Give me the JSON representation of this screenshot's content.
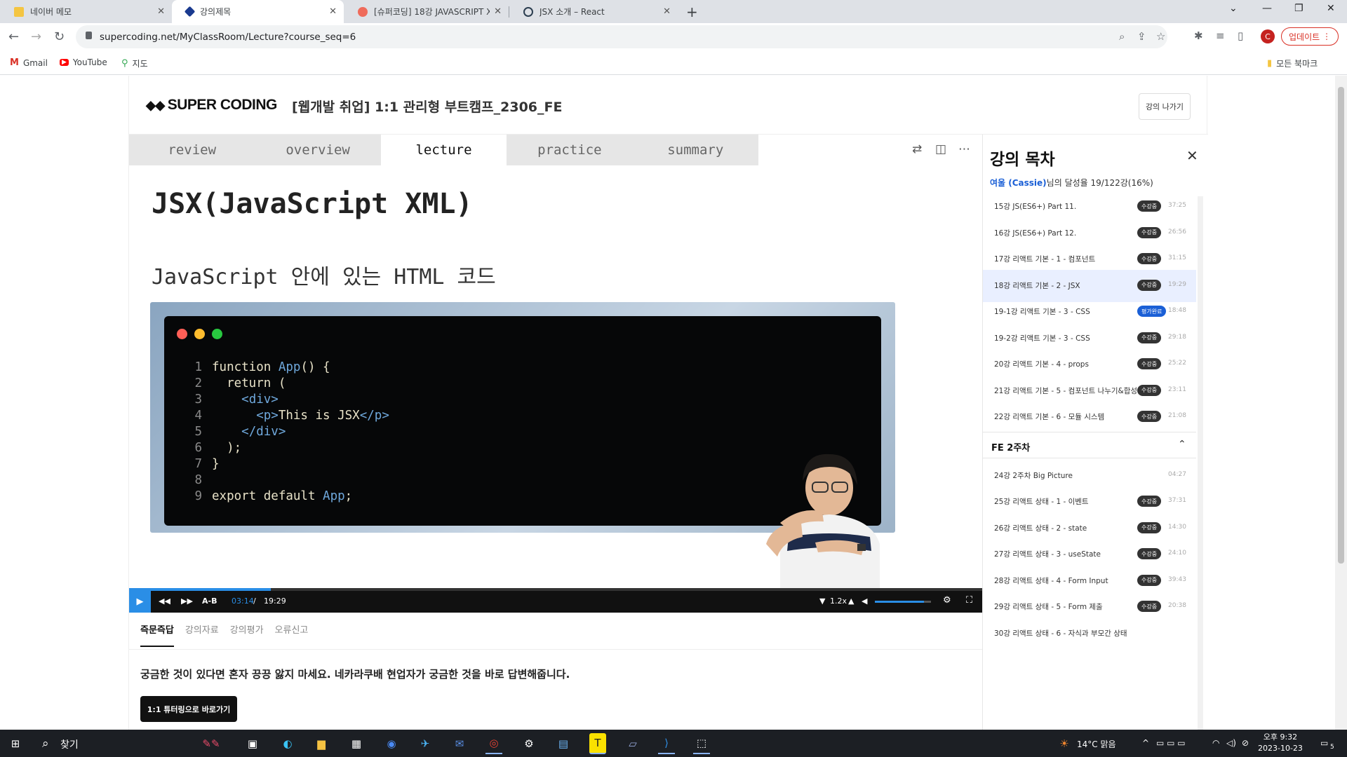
{
  "browser": {
    "tabs": [
      {
        "title": "네이버 메모",
        "active": false
      },
      {
        "title": "강의제목",
        "active": true
      },
      {
        "title": "[슈퍼코딩] 18강 JAVASCRIPT XML",
        "active": false
      },
      {
        "title": "JSX 소개 – React",
        "active": false
      }
    ],
    "url": "supercoding.net/MyClassRoom/Lecture?course_seq=6",
    "avatar_letter": "C",
    "update_label": "업데이트",
    "bookmarks": [
      "Gmail",
      "YouTube",
      "지도"
    ],
    "all_bookmarks_label": "모든 북마크"
  },
  "header": {
    "logo": "SUPER CODING",
    "course_title": "[웹개발 취업] 1:1 관리형 부트캠프_2306_FE",
    "exit_label": "강의 나가기"
  },
  "slide": {
    "tabs": [
      "review",
      "overview",
      "lecture",
      "practice",
      "summary"
    ],
    "active_tab": "lecture",
    "title": "JSX(JavaScript XML)",
    "subtitle": "JavaScript 안에 있는 HTML 코드",
    "code_lines": [
      {
        "n": "1",
        "text": "function App() {"
      },
      {
        "n": "2",
        "text": "  return ("
      },
      {
        "n": "3",
        "text": "    <div>"
      },
      {
        "n": "4",
        "text": "      <p>This is JSX</p>"
      },
      {
        "n": "5",
        "text": "    </div>"
      },
      {
        "n": "6",
        "text": "  );"
      },
      {
        "n": "7",
        "text": "}"
      },
      {
        "n": "8",
        "text": ""
      },
      {
        "n": "9",
        "text": "export default App;"
      }
    ]
  },
  "player": {
    "ab_label": "A-B",
    "current_time": "03:14",
    "separator": "/",
    "total_time": "19:29",
    "progress": 0.166,
    "speed": "1.2x",
    "volume": 0.88
  },
  "below": {
    "tabs": [
      "즉문즉답",
      "강의자료",
      "강의평가",
      "오류신고"
    ],
    "active_tab": "즉문즉답",
    "qa_text": "궁금한 것이 있다면 혼자 끙끙 앓지 마세요. 네카라쿠배 현업자가 궁금한 것을 바로 답변해줍니다.",
    "mentor_button": "1:1 튜터링으로 바로가기"
  },
  "toc": {
    "title": "강의 목차",
    "user_name": "여울 (Cassie)",
    "progress_text": "님의 달성율 19/122강(16%)",
    "items": [
      {
        "label": "15강 JS(ES6+) Part 11.",
        "badge": "수강중",
        "duration": "37:25"
      },
      {
        "label": "16강 JS(ES6+) Part 12.",
        "badge": "수강중",
        "duration": "26:56"
      },
      {
        "label": "17강 리액트 기본 - 1 - 컴포넌트",
        "badge": "수강중",
        "duration": "31:15"
      },
      {
        "label": "18강 리액트 기본 - 2 - JSX",
        "badge": "수강중",
        "duration": "19:29",
        "current": true
      },
      {
        "label": "19-1강 리액트 기본 - 3 - CSS",
        "badge": "평가완료",
        "duration": "18:48",
        "blue": true
      },
      {
        "label": "19-2강 리액트 기본 - 3 - CSS",
        "badge": "수강중",
        "duration": "29:18"
      },
      {
        "label": "20강 리액트 기본 - 4 - props",
        "badge": "수강중",
        "duration": "25:22"
      },
      {
        "label": "21강 리액트 기본 - 5 - 컴포넌트 나누기&합성",
        "badge": "수강중",
        "duration": "23:11"
      },
      {
        "label": "22강 리액트 기본 - 6 - 모듈 시스템",
        "badge": "수강중",
        "duration": "21:08"
      }
    ],
    "week_label": "FE 2주차",
    "week_items": [
      {
        "label": "24강 2주차 Big Picture",
        "badge": "",
        "duration": "04:27"
      },
      {
        "label": "25강 리액트 상태 - 1 - 이벤트",
        "badge": "수강중",
        "duration": "37:31"
      },
      {
        "label": "26강 리액트 상태 - 2 - state",
        "badge": "수강중",
        "duration": "14:30"
      },
      {
        "label": "27강 리액트 상태 - 3 - useState",
        "badge": "수강중",
        "duration": "24:10"
      },
      {
        "label": "28강 리액트 상태 - 4 - Form Input",
        "badge": "수강중",
        "duration": "39:43"
      },
      {
        "label": "29강 리액트 상태 - 5 - Form 제출",
        "badge": "수강중",
        "duration": "20:38"
      },
      {
        "label": "30강 리액트 상태 - 6 - 자식과 부모간 상태",
        "badge": "",
        "duration": ""
      }
    ]
  },
  "taskbar": {
    "search_label": "찾기",
    "weather": "14°C  맑음",
    "time": "오후 9:32",
    "date": "2023-10-23",
    "notif_count": "5"
  }
}
